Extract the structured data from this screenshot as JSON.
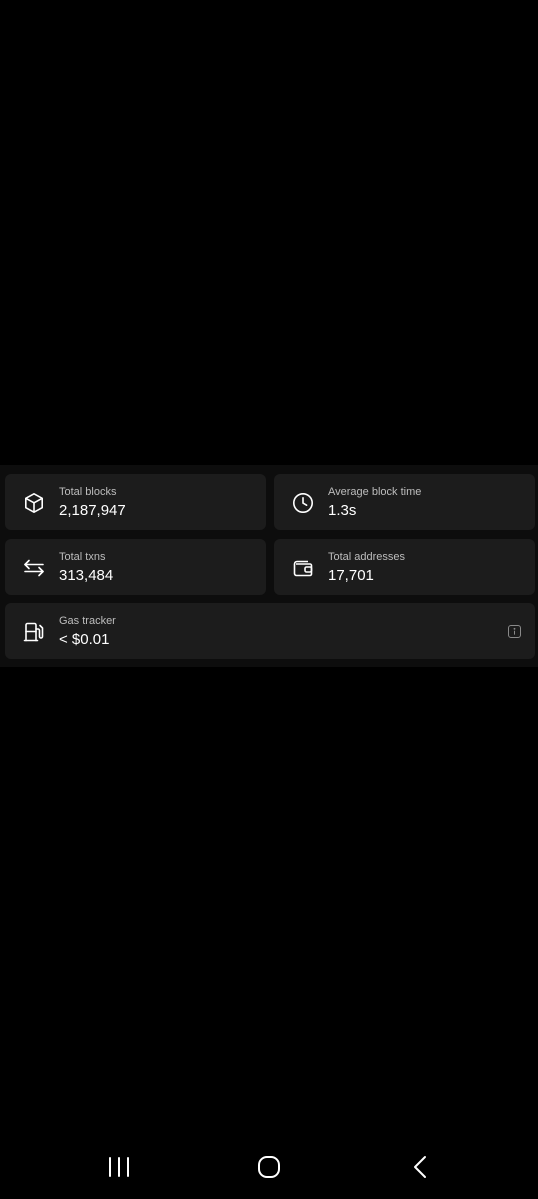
{
  "stats": {
    "total_blocks": {
      "label": "Total blocks",
      "value": "2,187,947",
      "icon": "cube-icon"
    },
    "average_block_time": {
      "label": "Average block time",
      "value": "1.3s",
      "icon": "clock-icon"
    },
    "total_txns": {
      "label": "Total txns",
      "value": "313,484",
      "icon": "transfer-arrows-icon"
    },
    "total_addresses": {
      "label": "Total addresses",
      "value": "17,701",
      "icon": "wallet-icon"
    },
    "gas_tracker": {
      "label": "Gas tracker",
      "value": "< $0.01",
      "icon": "gas-pump-icon",
      "info_icon": "info-icon"
    }
  },
  "nav_bar": {
    "buttons": [
      "recent-apps-icon",
      "home-icon",
      "back-icon"
    ]
  },
  "colors": {
    "background": "#000000",
    "panel": "#0d0d0d",
    "card": "#1c1c1c",
    "label": "#bdbdbd",
    "value": "#ffffff"
  }
}
